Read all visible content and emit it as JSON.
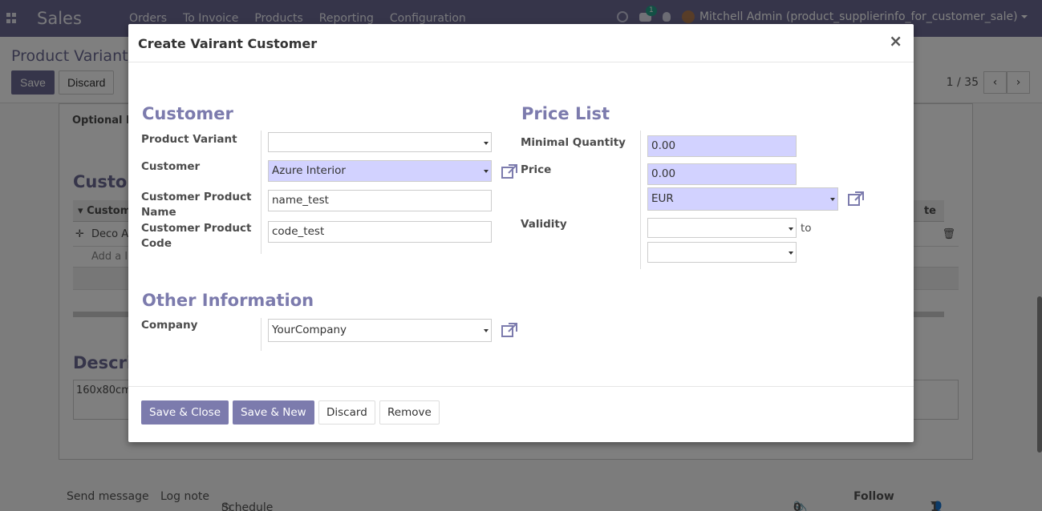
{
  "app": {
    "brand": "Sales",
    "menu": [
      "Orders",
      "To Invoice",
      "Products",
      "Reporting",
      "Configuration"
    ],
    "chat_count": "1",
    "user": "Mitchell Admin (product_supplierinfo_for_customer_sale)"
  },
  "control_panel": {
    "breadcrumb": "Product Variants",
    "save_label": "Save",
    "discard_label": "Discard",
    "pager": "1 / 35"
  },
  "background_form": {
    "optional_label": "Optional P",
    "customer_section": "Custom",
    "table_head_first": "Custom",
    "table_head_last": "te",
    "row_value": "Deco A",
    "add_line": "Add a l",
    "description_title": "Descri",
    "description_value": "160x80cm"
  },
  "chatter": {
    "send_message": "Send message",
    "log_note": "Log note",
    "schedule_activity": "Schedule activity",
    "attachments": "0",
    "follow": "Follow",
    "followers": "1"
  },
  "modal": {
    "title": "Create Vairant Customer",
    "close": "×",
    "customer_section": {
      "title": "Customer",
      "product_variant_label": "Product Variant",
      "product_variant_value": "",
      "customer_label": "Customer",
      "customer_value": "Azure Interior",
      "customer_product_name_label": "Customer Product Name",
      "customer_product_name_value": "name_test",
      "customer_product_code_label": "Customer Product Code",
      "customer_product_code_value": "code_test"
    },
    "pricelist_section": {
      "title": "Price List",
      "min_qty_label": "Minimal Quantity",
      "min_qty_value": "0.00",
      "price_label": "Price",
      "price_value": "0.00",
      "currency_value": "EUR",
      "validity_label": "Validity",
      "date_start_value": "",
      "to_label": "to",
      "date_end_value": ""
    },
    "other_section": {
      "title": "Other Information",
      "company_label": "Company",
      "company_value": "YourCompany"
    },
    "footer": {
      "save_close": "Save & Close",
      "save_new": "Save & New",
      "discard": "Discard",
      "remove": "Remove"
    }
  },
  "colors": {
    "navbar": "#6c6b94",
    "primary_button": "#7c7bad",
    "required_field": "#d2d2ff",
    "section_title": "#7c7bad"
  }
}
